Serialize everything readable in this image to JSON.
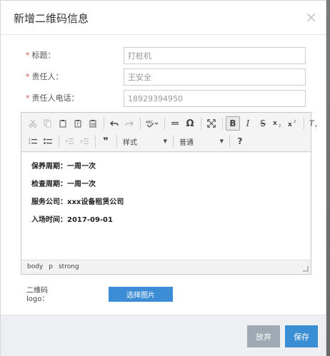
{
  "dialog": {
    "title": "新增二维码信息",
    "close_icon": "close-icon"
  },
  "form": {
    "fields": [
      {
        "label": "标题：",
        "required": true,
        "value": "打桩机"
      },
      {
        "label": "责任人：",
        "required": true,
        "value": "王安全"
      },
      {
        "label": "责任人电话：",
        "required": true,
        "value": "18929394950"
      }
    ],
    "required_marker": "*"
  },
  "editor": {
    "toolbar": {
      "row1": [
        "cut-icon",
        "copy-icon",
        "paste-icon",
        "paste-text-icon",
        "paste-word-icon",
        "undo-icon",
        "redo-icon",
        "spellcheck-icon",
        "horizontal-rule-icon",
        "special-char-icon",
        "maximize-icon",
        "bold-icon",
        "italic-icon",
        "strike-icon",
        "subscript-icon",
        "superscript-icon",
        "remove-format-icon"
      ],
      "row2": [
        "numbered-list-icon",
        "bulleted-list-icon",
        "outdent-icon",
        "indent-icon",
        "blockquote-icon",
        "styles-combo",
        "format-combo",
        "help-icon"
      ],
      "styles_label": "样式",
      "format_label": "普通",
      "bold": "B",
      "italic": "I",
      "strike": "S",
      "omega": "Ω",
      "quote": "❞",
      "help": "?"
    },
    "content": [
      "保养周期：一周一次",
      "检查周期：一周一次",
      "服务公司：xxx设备租赁公司",
      "入场时间：2017-09-01"
    ],
    "status_path": [
      "body",
      "p",
      "strong"
    ]
  },
  "logo": {
    "label": "二维码logo：",
    "button_label": "选择图片"
  },
  "footer": {
    "discard_label": "放弃",
    "save_label": "保存"
  },
  "colors": {
    "primary": "#3a8ed4",
    "secondary": "#9ea9b4",
    "required": "#d9534f"
  }
}
